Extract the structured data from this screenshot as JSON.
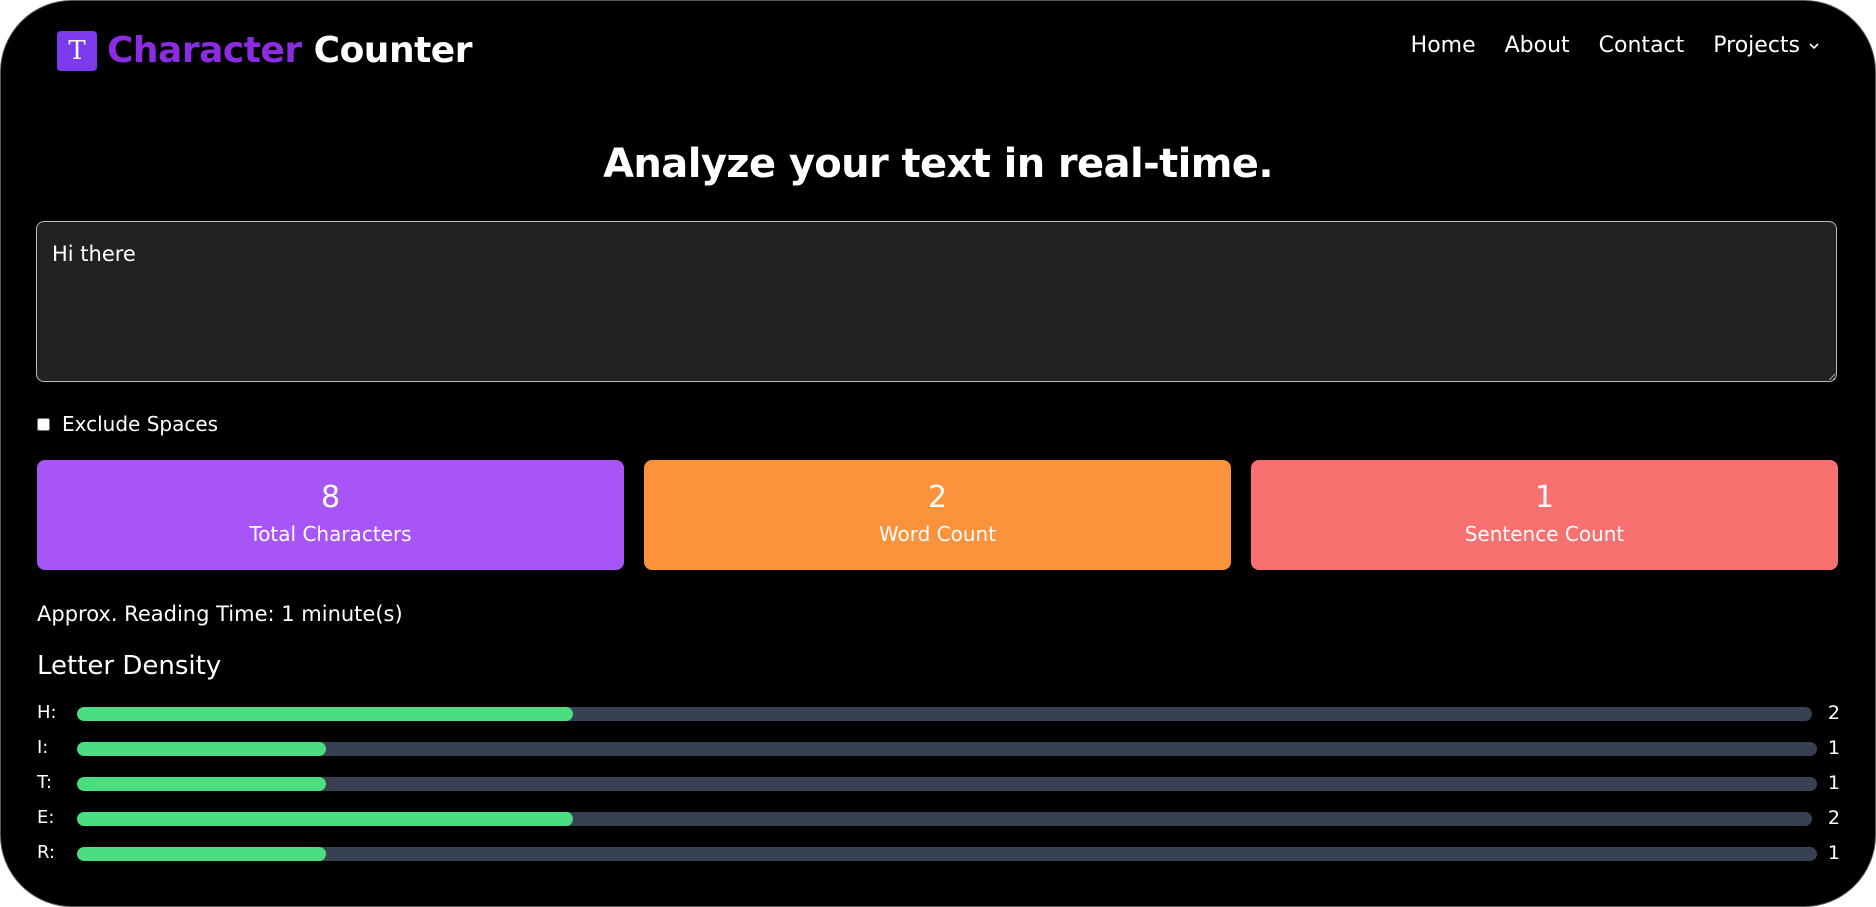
{
  "brand": {
    "logo_glyph": "T",
    "accent": "Character",
    "rest": "Counter"
  },
  "nav": {
    "home": "Home",
    "about": "About",
    "contact": "Contact",
    "projects": "Projects"
  },
  "headline": "Analyze your text in real-time.",
  "editor": {
    "value": "Hi there"
  },
  "options": {
    "exclude_spaces_label": "Exclude Spaces",
    "exclude_spaces_checked": false
  },
  "stats": {
    "total_characters": {
      "value": "8",
      "label": "Total Characters",
      "color": "#a855f7"
    },
    "word_count": {
      "value": "2",
      "label": "Word Count",
      "color": "#fb923c"
    },
    "sentence_count": {
      "value": "1",
      "label": "Sentence Count",
      "color": "#f87171"
    }
  },
  "reading_time": "Approx. Reading Time: 1 minute(s)",
  "density": {
    "title": "Letter Density",
    "bar_color": "#4ade80",
    "track_color": "#374151",
    "rows": [
      {
        "letter": "H:",
        "count": "2",
        "fraction": 0.2857
      },
      {
        "letter": "I:",
        "count": "1",
        "fraction": 0.1429
      },
      {
        "letter": "T:",
        "count": "1",
        "fraction": 0.1429
      },
      {
        "letter": "E:",
        "count": "2",
        "fraction": 0.2857
      },
      {
        "letter": "R:",
        "count": "1",
        "fraction": 0.1429
      }
    ]
  }
}
